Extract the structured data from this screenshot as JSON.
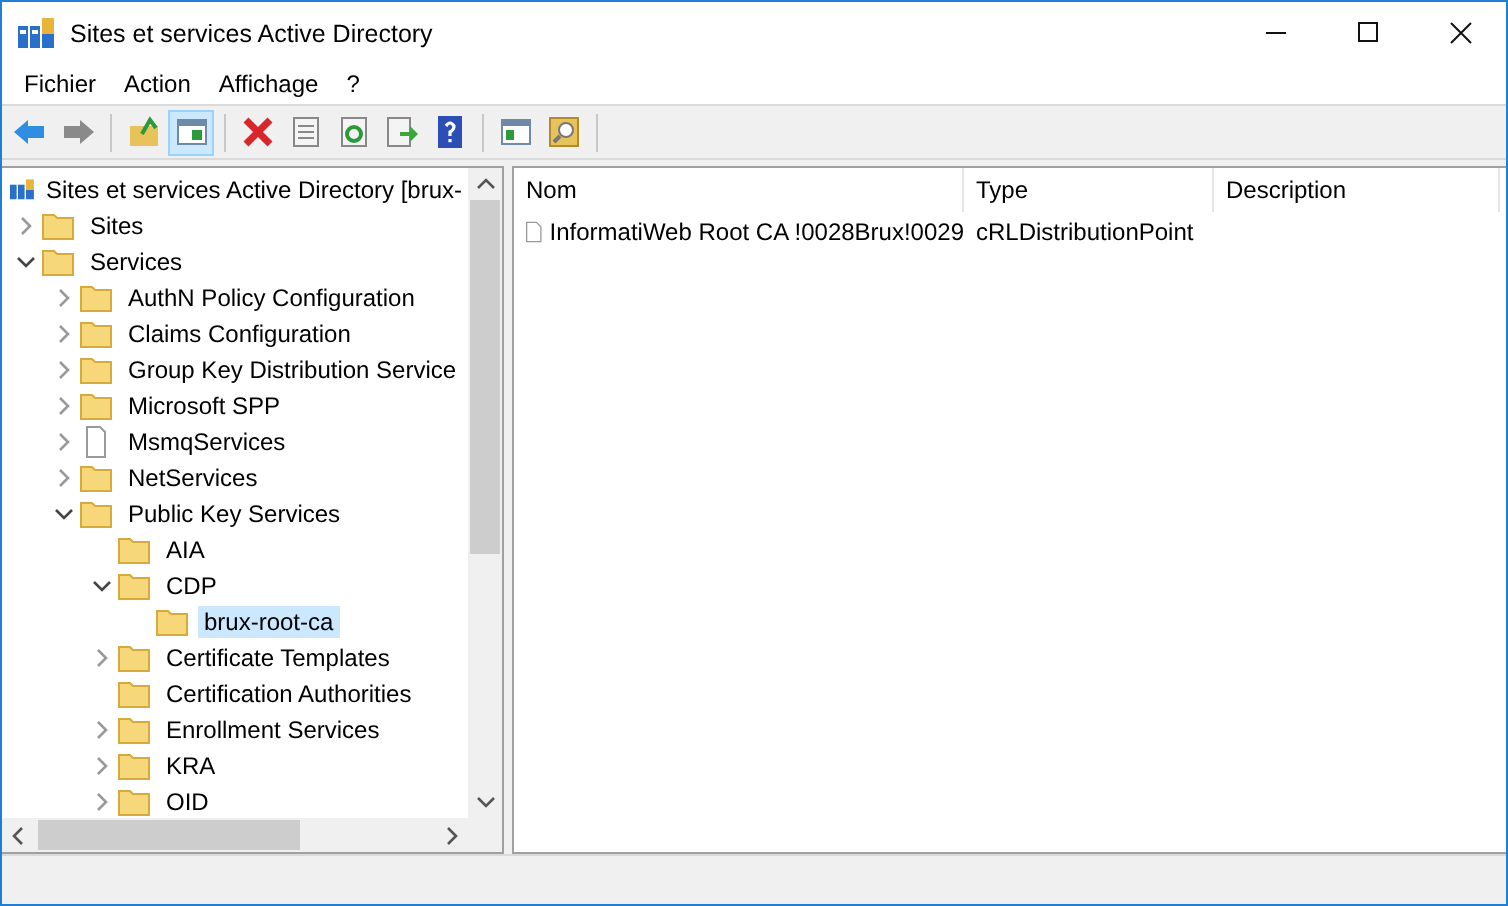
{
  "window": {
    "title": "Sites et services Active Directory"
  },
  "menu": [
    "Fichier",
    "Action",
    "Affichage",
    "?"
  ],
  "toolbar": [
    {
      "pressed": false
    },
    {
      "pressed": false
    },
    {
      "pressed": false
    },
    {
      "pressed": true
    },
    {
      "pressed": false
    },
    {
      "pressed": false
    },
    {
      "pressed": false
    },
    {
      "pressed": false
    },
    {
      "pressed": false
    },
    {
      "pressed": false
    },
    {
      "pressed": false
    }
  ],
  "tree": {
    "label": "Sites et services Active Directory [brux-",
    "children": [
      {
        "label": "Sites",
        "kind": "folder",
        "expanded": false,
        "selected": false
      },
      {
        "label": "Services",
        "kind": "folder",
        "expanded": true,
        "selected": false,
        "children": [
          {
            "label": "AuthN Policy Configuration",
            "kind": "folder",
            "expanded": false,
            "selected": false
          },
          {
            "label": "Claims Configuration",
            "kind": "folder",
            "expanded": false,
            "selected": false
          },
          {
            "label": "Group Key Distribution Service",
            "kind": "folder",
            "expanded": false,
            "selected": false
          },
          {
            "label": "Microsoft SPP",
            "kind": "folder",
            "expanded": false,
            "selected": false
          },
          {
            "label": "MsmqServices",
            "kind": "file",
            "expanded": false,
            "selected": false
          },
          {
            "label": "NetServices",
            "kind": "folder",
            "expanded": false,
            "selected": false
          },
          {
            "label": "Public Key Services",
            "kind": "folder",
            "expanded": true,
            "selected": false,
            "children": [
              {
                "label": "AIA",
                "kind": "folder",
                "selected": false
              },
              {
                "label": "CDP",
                "kind": "folder",
                "expanded": true,
                "selected": false,
                "children": [
                  {
                    "label": "brux-root-ca",
                    "kind": "folder",
                    "selected": true
                  }
                ]
              },
              {
                "label": "Certificate Templates",
                "kind": "folder",
                "expanded": false,
                "selected": false
              },
              {
                "label": "Certification Authorities",
                "kind": "folder",
                "selected": false
              },
              {
                "label": "Enrollment Services",
                "kind": "folder",
                "expanded": false,
                "selected": false
              },
              {
                "label": "KRA",
                "kind": "folder",
                "expanded": false,
                "selected": false
              },
              {
                "label": "OID",
                "kind": "folder",
                "expanded": false,
                "selected": false
              }
            ]
          }
        ]
      }
    ]
  },
  "list": {
    "columns": [
      "Nom",
      "Type",
      "Description"
    ],
    "rows": [
      {
        "name": "InformatiWeb Root CA !0028Brux!0029",
        "type": "cRLDistributionPoint"
      }
    ]
  }
}
